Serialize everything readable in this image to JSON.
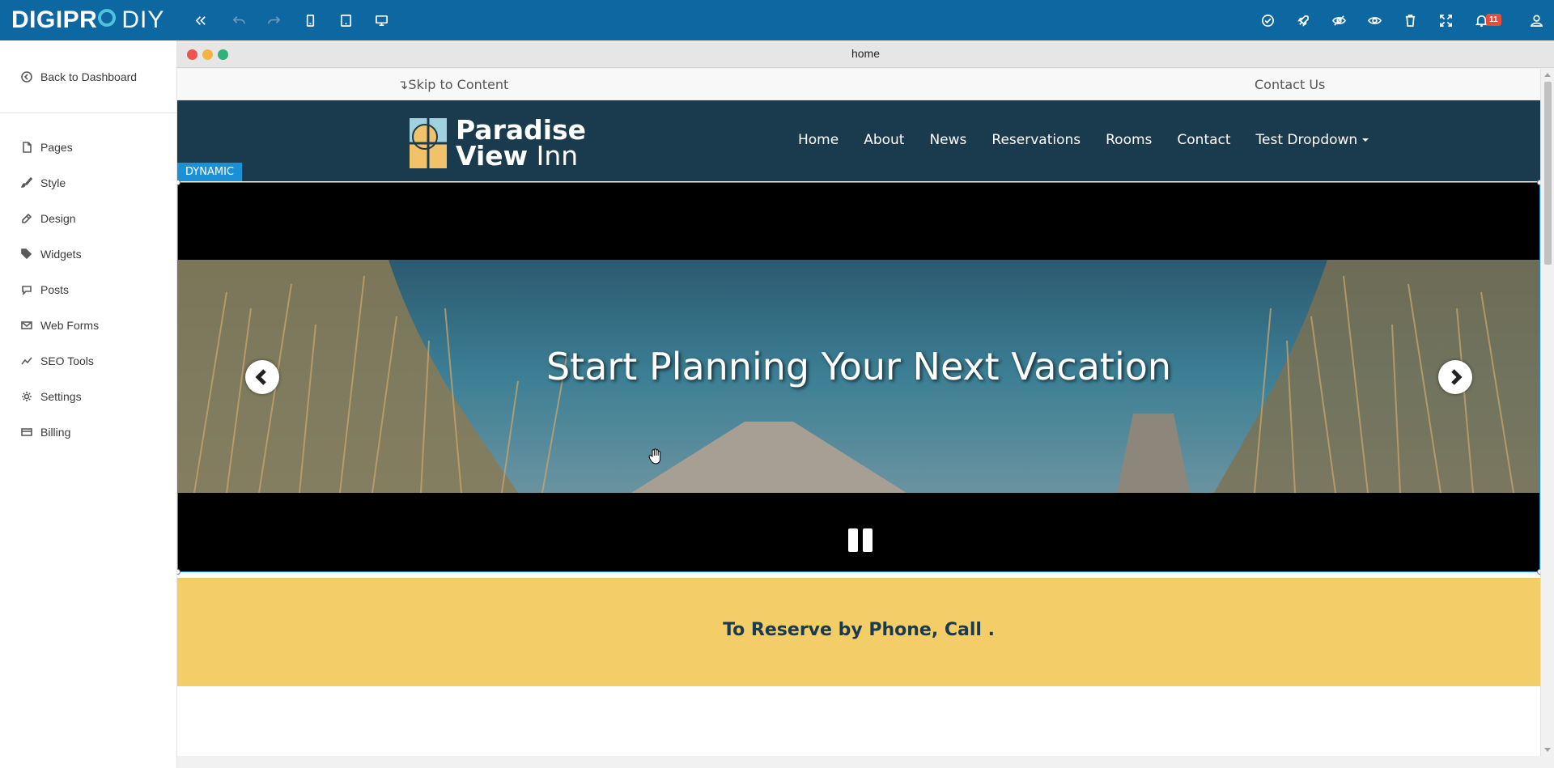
{
  "app": {
    "logo_left": "DIGIPR",
    "logo_right": "DIY",
    "notifications_count": "11",
    "toolbar_icons": [
      "collapse-icon",
      "undo-icon",
      "redo-icon",
      "mobile-icon",
      "tablet-icon",
      "desktop-icon",
      "check-icon",
      "rocket-icon",
      "eye-slash-icon",
      "eye-icon",
      "trash-icon",
      "fullscreen-icon",
      "bell-icon",
      "user-icon"
    ]
  },
  "sidebar": {
    "back_label": "Back to Dashboard",
    "items": [
      {
        "label": "Pages",
        "icon": "page-icon"
      },
      {
        "label": "Style",
        "icon": "brush-icon"
      },
      {
        "label": "Design",
        "icon": "design-icon"
      },
      {
        "label": "Widgets",
        "icon": "tag-icon"
      },
      {
        "label": "Posts",
        "icon": "chat-icon"
      },
      {
        "label": "Web Forms",
        "icon": "mail-icon"
      },
      {
        "label": "SEO Tools",
        "icon": "trend-icon"
      },
      {
        "label": "Settings",
        "icon": "gear-icon"
      },
      {
        "label": "Billing",
        "icon": "card-icon"
      }
    ]
  },
  "preview": {
    "window_title": "home"
  },
  "site": {
    "skip_label": "↴Skip to Content",
    "contact_label": "Contact Us",
    "logo_line1": "Paradise",
    "logo_line2": "View",
    "logo_line2b": "Inn",
    "nav": [
      "Home",
      "About",
      "News",
      "Reservations",
      "Rooms",
      "Contact",
      "Test Dropdown"
    ],
    "dynamic_label": "DYNAMIC",
    "slide_heading": "Start Planning Your Next Vacation",
    "band_text": "To Reserve by Phone, Call   ."
  },
  "colors": {
    "topbar": "#0d67a0",
    "navbar": "#1a3a4d",
    "band": "#f3cd68",
    "dynamic": "#1c90d6"
  }
}
